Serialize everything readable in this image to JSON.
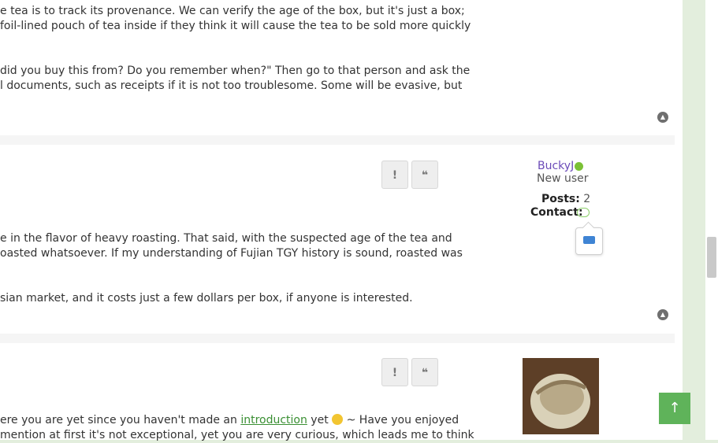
{
  "posts": [
    {
      "lines": [
        "e tea is to track its provenance. We can verify the age of the box, but it's just a box;",
        " foil-lined pouch of tea inside if they think it will cause the tea to be sold more quickly",
        "did you buy this from? Do you remember when?\" Then go to that person and ask the",
        "l documents, such as receipts if it is not too troublesome. Some will be evasive, but"
      ]
    },
    {
      "report_label": "!",
      "quote_label": "❝",
      "author": {
        "username": "BuckyJ",
        "rank": "New user",
        "posts_label": "Posts:",
        "posts_count": "2",
        "contact_label": "Contact:"
      },
      "lines": [
        "e in the flavor of heavy roasting. That said, with the suspected age of the tea and",
        "oasted whatsoever. If my understanding of Fujian TGY history is sound, roasted was",
        "sian market, and it costs just a few dollars per box, if anyone is interested."
      ]
    },
    {
      "report_label": "!",
      "quote_label": "❝",
      "line1_before": "ere you are yet since you haven't made an ",
      "line1_link": "introduction",
      "line1_after": " ~ Have you enjoyed",
      "line1_mid": " yet",
      "line2": " mention at first it's not exceptional, yet you are very curious, which leads me to think"
    }
  ],
  "top_icon": "chevron-up-icon",
  "scroll_top_icon": "arrow-up-icon"
}
